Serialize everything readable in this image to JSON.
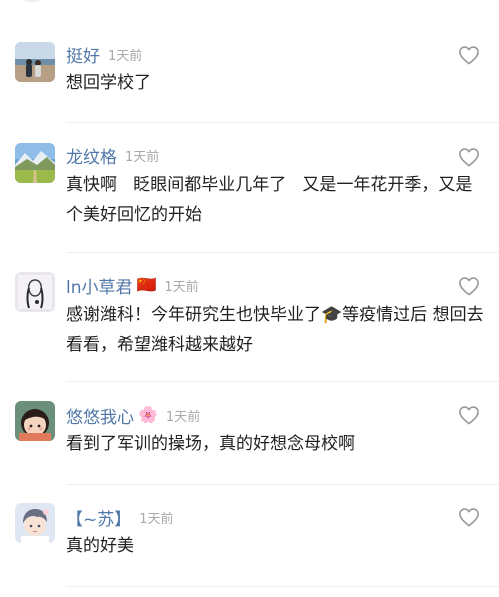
{
  "comments": [
    {
      "username": "挺好",
      "badge": "",
      "time": "1天前",
      "text": "想回学校了",
      "avatar_icon": "seaside-couple-photo"
    },
    {
      "username": "龙纹格",
      "badge": "",
      "time": "1天前",
      "text": "真快啊   眨眼间都毕业几年了   又是一年花开季，又是个美好回忆的开始",
      "avatar_icon": "mountain-landscape-photo"
    },
    {
      "username": "ln小草君",
      "badge": "🇨🇳",
      "time": "1天前",
      "text": "感谢潍科！今年研究生也快毕业了🎓等疫情过后 想回去看看，希望潍科越来越好",
      "avatar_icon": "sketch-portrait"
    },
    {
      "username": "悠悠我心",
      "badge": "🌸",
      "time": "1天前",
      "text": "看到了军训的操场，真的好想念母校啊",
      "avatar_icon": "cartoon-girl"
    },
    {
      "username": "【~苏】",
      "badge": "",
      "time": "1天前",
      "text": "真的好美",
      "avatar_icon": "anime-boy"
    }
  ],
  "colors": {
    "username": "#5178a8",
    "time": "#a9a9a9",
    "text": "#1f1f1f",
    "heart": "#9a9a9a",
    "divider": "#eeeeee"
  }
}
